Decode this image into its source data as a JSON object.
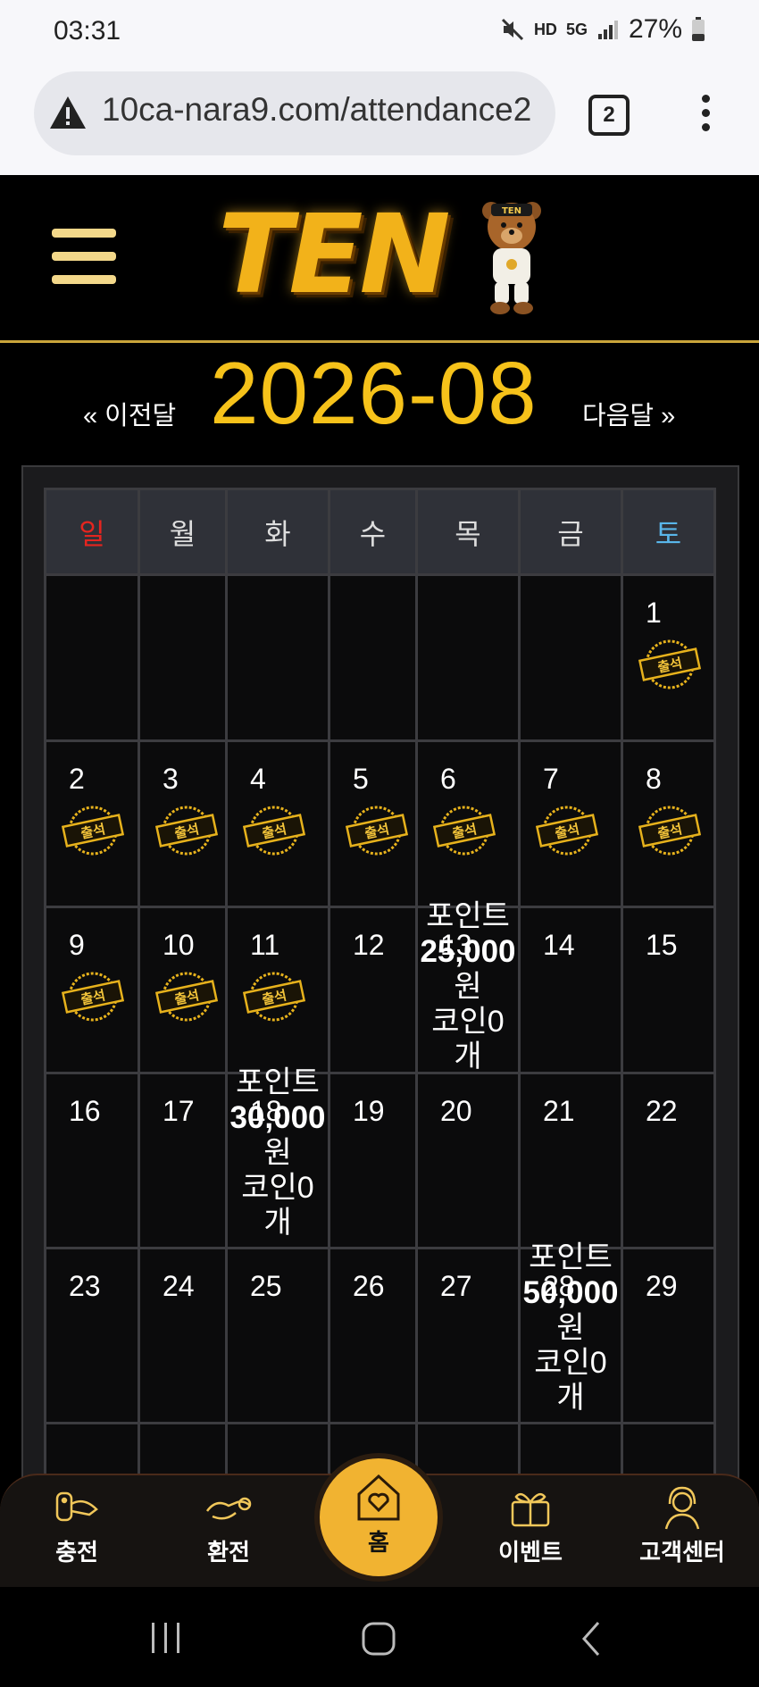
{
  "status_bar": {
    "time": "03:31",
    "hd_label": "HD",
    "net_label": "5G",
    "battery": "27%"
  },
  "browser": {
    "url": "10ca-nara9.com/attendance2",
    "tab_count": "2"
  },
  "header": {
    "logo_text": "TEN",
    "bear_badge": "TEN"
  },
  "calendar": {
    "prev_label": "« 이전달",
    "month": "2026-08",
    "next_label": "다음달 »",
    "weekdays": [
      "일",
      "월",
      "화",
      "수",
      "목",
      "금",
      "토"
    ],
    "stamp_text": "출석",
    "reward_point_label": "포인트",
    "reward_won": "원",
    "reward_coin": "코인0",
    "reward_unit": "개",
    "rewards": {
      "13": "25,000",
      "18": "30,000",
      "28": "50,000"
    },
    "days": {
      "d1": "1",
      "d2": "2",
      "d3": "3",
      "d4": "4",
      "d5": "5",
      "d6": "6",
      "d7": "7",
      "d8": "8",
      "d9": "9",
      "d10": "10",
      "d11": "11",
      "d12": "12",
      "d13": "13",
      "d14": "14",
      "d15": "15",
      "d16": "16",
      "d17": "17",
      "d18": "18",
      "d19": "19",
      "d20": "20",
      "d21": "21",
      "d22": "22",
      "d23": "23",
      "d24": "24",
      "d25": "25",
      "d26": "26",
      "d27": "27",
      "d28": "28",
      "d29": "29"
    }
  },
  "bottom_nav": {
    "deposit": "충전",
    "withdraw": "환전",
    "home": "홈",
    "event": "이벤트",
    "support": "고객센터"
  },
  "colors": {
    "accent_gold": "#f6c21a",
    "sunday_red": "#e5251f",
    "saturday_blue": "#59b6ea"
  }
}
